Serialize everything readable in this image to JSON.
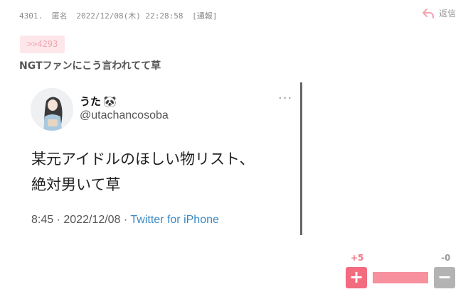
{
  "post": {
    "number": "4301.",
    "author": "匿名",
    "datetime": "2022/12/08(木) 22:28:58",
    "report": "[通報]",
    "reply_label": "返信",
    "anchor": ">>4293",
    "comment": "NGTファンにこう言われてて草"
  },
  "tweet": {
    "display_name": "うた",
    "emoji": "🐼",
    "handle": "@utachancosoba",
    "more": "···",
    "text_line1": "某元アイドルのほしい物リスト、",
    "text_line2": "絶対男いて草",
    "time": "8:45",
    "date": "2022/12/08",
    "sep": "·",
    "source": "Twitter for iPhone"
  },
  "votes": {
    "plus_count": "+5",
    "minus_count": "-0",
    "plus_symbol": "+",
    "minus_symbol": "−",
    "ratio": 1.0
  },
  "colors": {
    "accent_pink": "#f26b7f",
    "bar_pink": "#f7919d",
    "link_blue": "#3b88c3",
    "anchor_bg": "#fde7ea"
  }
}
